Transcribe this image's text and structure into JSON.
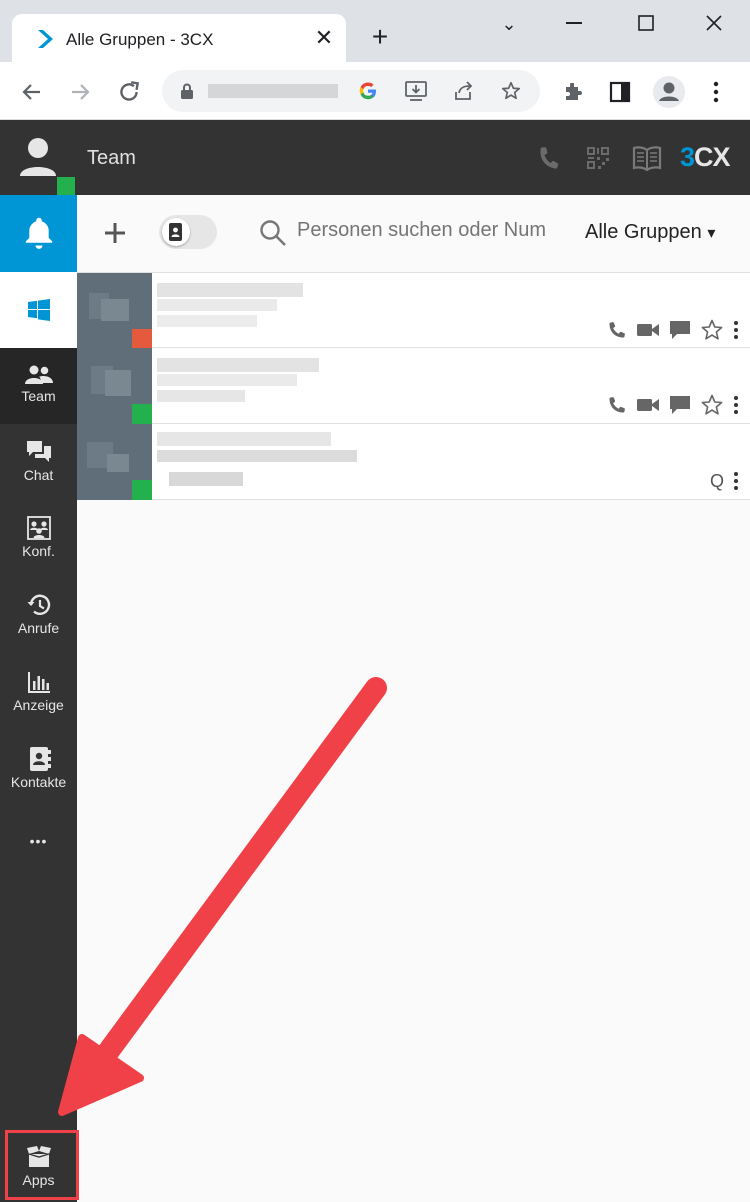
{
  "browser": {
    "tab_title": "Alle Gruppen - 3CX",
    "tab_close": "✕",
    "new_tab": "+",
    "win_minimize": "⌄",
    "win_restore_down": "—",
    "win_maximize": "☐",
    "win_close": "✕"
  },
  "app": {
    "header_title": "Team",
    "brand": "3CX",
    "colors": {
      "brand_blue": "#0096d6",
      "sidebar_bg": "#333333",
      "status_online": "#22b14c",
      "status_busy": "#e55a3c",
      "arrow_red": "#f04048"
    }
  },
  "toolbar": {
    "search_placeholder": "Personen suchen oder Num",
    "groups_label": "Alle Gruppen",
    "groups_caret": "▾"
  },
  "sidebar": {
    "items": [
      {
        "label": "Team",
        "icon": "team-icon"
      },
      {
        "label": "Chat",
        "icon": "chat-icon"
      },
      {
        "label": "Konf.",
        "icon": "conference-icon"
      },
      {
        "label": "Anrufe",
        "icon": "history-icon"
      },
      {
        "label": "Anzeige",
        "icon": "chart-icon"
      },
      {
        "label": "Kontakte",
        "icon": "contacts-icon"
      }
    ],
    "more": "•••",
    "apps_label": "Apps"
  },
  "contacts": [
    {
      "status": "busy"
    },
    {
      "status": "online"
    },
    {
      "status": "online",
      "queue_badge": "Q"
    }
  ]
}
